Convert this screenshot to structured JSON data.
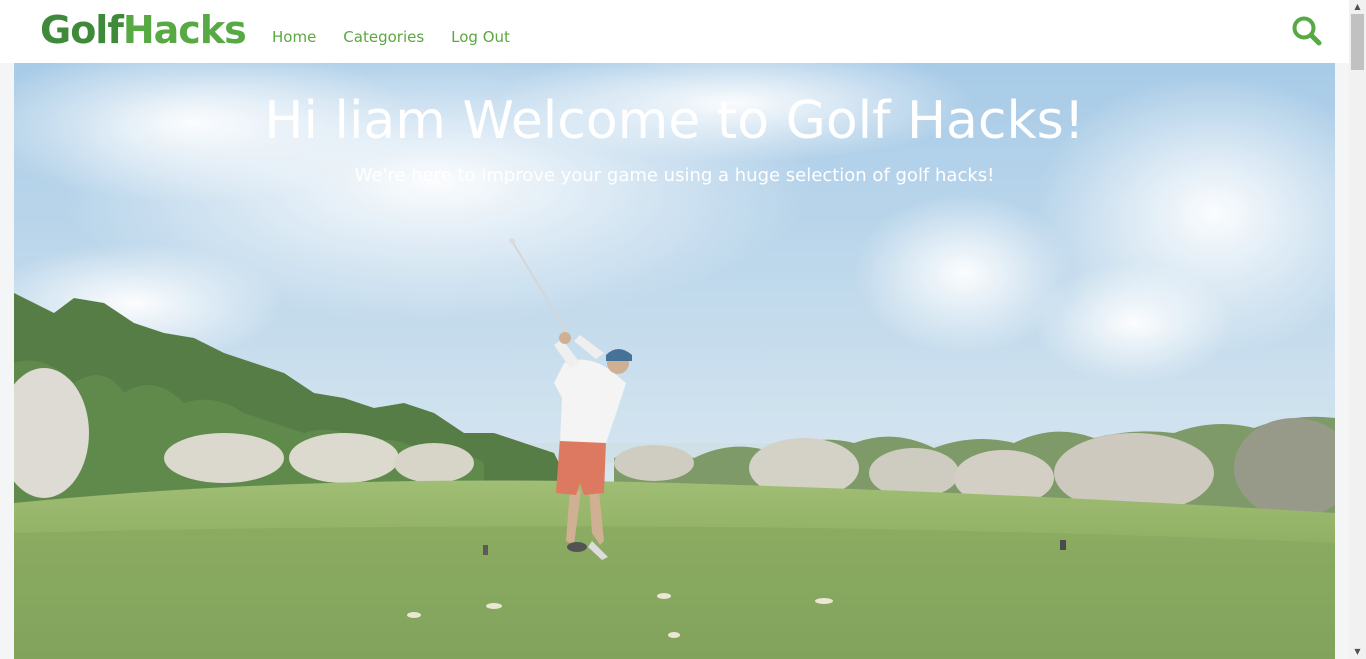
{
  "brand": {
    "part1": "Golf",
    "part2": "Hacks"
  },
  "nav": {
    "home": "Home",
    "categories": "Categories",
    "logout": "Log Out"
  },
  "icons": {
    "search": "search-icon"
  },
  "hero": {
    "title": "Hi liam Welcome to Golf Hacks!",
    "subtitle": "We're here to improve your game using a huge selection of golf hacks!"
  },
  "colors": {
    "brand_dark": "#3f8a3a",
    "brand_light": "#57a943",
    "nav_link": "#5aa840"
  }
}
